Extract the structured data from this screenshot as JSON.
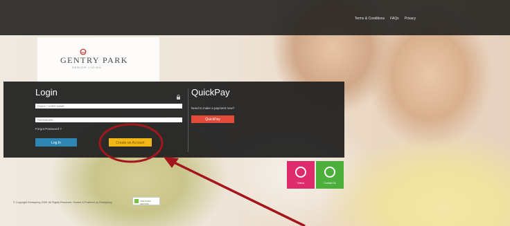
{
  "header": {
    "links": [
      "Terms & Conditions",
      "FAQs",
      "Privacy"
    ]
  },
  "logo": {
    "name": "GENTRY PARK",
    "tagline": "SENIOR LIVING"
  },
  "login": {
    "title": "Login",
    "email_placeholder": "EMAIL / USER NAME",
    "password_placeholder": "PASSWORD",
    "forgot_label": "Forgot Password ?",
    "login_button": "Log In",
    "create_button": "Create an Account"
  },
  "quickpay": {
    "title": "QuickPay",
    "prompt": "Need to make a payment now?",
    "button": "QuickPay"
  },
  "tiles": {
    "video_label": "Videos",
    "phone_label": "Contact Us"
  },
  "footer": {
    "copyright": "© Copyright Rentspring 2020. All Rights Reserved. Hosted & Powered by Rentspring",
    "badge": "CERTIFIED SECURE"
  },
  "colors": {
    "login_button": "#2d86b4",
    "create_button": "#f2b616",
    "quickpay_button": "#e24a3b",
    "video_tile": "#dd2b6c",
    "phone_tile": "#4caf3c",
    "annotation": "#a3161e"
  }
}
